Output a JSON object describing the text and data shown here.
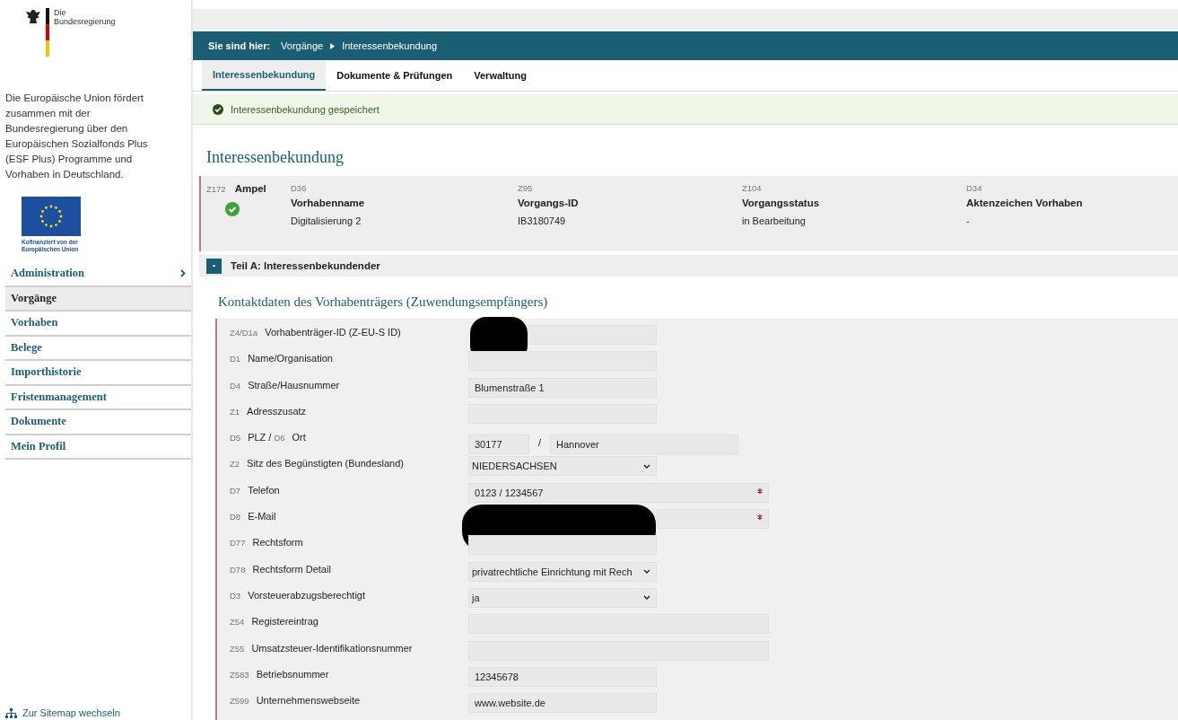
{
  "sidebar": {
    "logo_text": "Die\nBundesregierung",
    "intro": "Die Europäische Union fördert zusammen mit der Bundesregierung über den Europäischen Sozialfonds Plus (ESF Plus) Programme und Vorhaben in Deutschland.",
    "eu_caption": "Kofinanziert von der\nEuropäischen Union",
    "items": [
      {
        "label": "Administration",
        "selected": false,
        "has_submenu": true
      },
      {
        "label": "Vorgänge",
        "selected": true,
        "has_submenu": false
      },
      {
        "label": "Vorhaben",
        "selected": false,
        "has_submenu": false
      },
      {
        "label": "Belege",
        "selected": false,
        "has_submenu": false
      },
      {
        "label": "Importhistorie",
        "selected": false,
        "has_submenu": false
      },
      {
        "label": "Fristenmanagement",
        "selected": false,
        "has_submenu": false
      },
      {
        "label": "Dokumente",
        "selected": false,
        "has_submenu": false
      },
      {
        "label": "Mein Profil",
        "selected": false,
        "has_submenu": false
      }
    ],
    "sitemap_link": "Zur Sitemap wechseln"
  },
  "breadcrumb": {
    "label": "Sie sind hier:",
    "items": [
      "Vorgänge",
      "Interessenbekundung"
    ]
  },
  "tabs": [
    {
      "label": "Interessenbekundung",
      "selected": true
    },
    {
      "label": "Dokumente & Prüfungen",
      "selected": false
    },
    {
      "label": "Verwaltung",
      "selected": false
    }
  ],
  "notice": "Interessenbekundung gespeichert",
  "page_title": "Interessenbekundung",
  "summary": {
    "ampel": {
      "code": "Z172",
      "label": "Ampel",
      "ok": true
    },
    "columns": [
      {
        "code": "D36",
        "label": "Vorhabenname",
        "value": "Digitalisierung 2"
      },
      {
        "code": "Z95",
        "label": "Vorgangs-ID",
        "value": "IB3180749"
      },
      {
        "code": "Z104",
        "label": "Vorgangsstatus",
        "value": "in Bearbeitung"
      },
      {
        "code": "D34",
        "label": "Aktenzeichen Vorhaben",
        "value": "-"
      }
    ]
  },
  "section": {
    "toggle": "-",
    "title": "Teil A: Interessenbekundender",
    "expanded": true,
    "subtitle": "Kontaktdaten des Vorhabenträgers (Zuwendungsempfängers)",
    "rows": [
      {
        "kind": "short",
        "code": "Z4/D1a",
        "label": "Vorhabenträger-ID (Z-EU-S ID)",
        "value": "",
        "required": false,
        "redacted": true
      },
      {
        "kind": "short",
        "code": "D1",
        "label": "Name/Organisation",
        "value": "",
        "required": false,
        "redacted": false
      },
      {
        "kind": "short",
        "code": "D4",
        "label": "Straße/Hausnummer",
        "value": "Blumenstraße 1",
        "required": false,
        "redacted": false
      },
      {
        "kind": "short",
        "code": "Z1",
        "label": "Adresszusatz",
        "value": "",
        "required": false,
        "redacted": false
      },
      {
        "kind": "pair",
        "labels": [
          {
            "code": "D5",
            "text": "PLZ"
          },
          {
            "code": "D6",
            "text": "Ort"
          }
        ],
        "label_separator": "/",
        "values": [
          "30177",
          "Hannover"
        ],
        "value_separator": "/"
      },
      {
        "kind": "select",
        "code": "Z2",
        "label": "Sitz des Begünstigten (Bundesland)",
        "value": "NIEDERSACHSEN",
        "required": false,
        "redacted": false
      },
      {
        "kind": "wide",
        "code": "D7",
        "label": "Telefon",
        "value": "0123 / 1234567",
        "required": true,
        "redacted": false
      },
      {
        "kind": "wide",
        "code": "D8",
        "label": "E-Mail",
        "value": "",
        "required": true,
        "redacted": true
      },
      {
        "kind": "short",
        "code": "D77",
        "label": "Rechtsform",
        "value": "",
        "required": false,
        "redacted": false
      },
      {
        "kind": "select",
        "code": "D78",
        "label": "Rechtsform Detail",
        "value": "privatrechtliche Einrichtung mit Rech",
        "required": false,
        "redacted": false
      },
      {
        "kind": "select",
        "code": "D3",
        "label": "Vorsteuerabzugsberechtigt",
        "value": "ja",
        "required": false,
        "redacted": false
      },
      {
        "kind": "wide",
        "code": "Z54",
        "label": "Registereintrag",
        "value": "",
        "required": false,
        "redacted": false
      },
      {
        "kind": "wide",
        "code": "Z55",
        "label": "Umsatzsteuer-Identifikationsnummer",
        "value": "",
        "required": false,
        "redacted": false
      },
      {
        "kind": "short",
        "code": "Z583",
        "label": "Betriebsnummer",
        "value": "12345678",
        "required": false,
        "redacted": false
      },
      {
        "kind": "short",
        "code": "Z599",
        "label": "Unternehmenswebseite",
        "value": "www.website.de",
        "required": false,
        "redacted": false
      }
    ]
  }
}
